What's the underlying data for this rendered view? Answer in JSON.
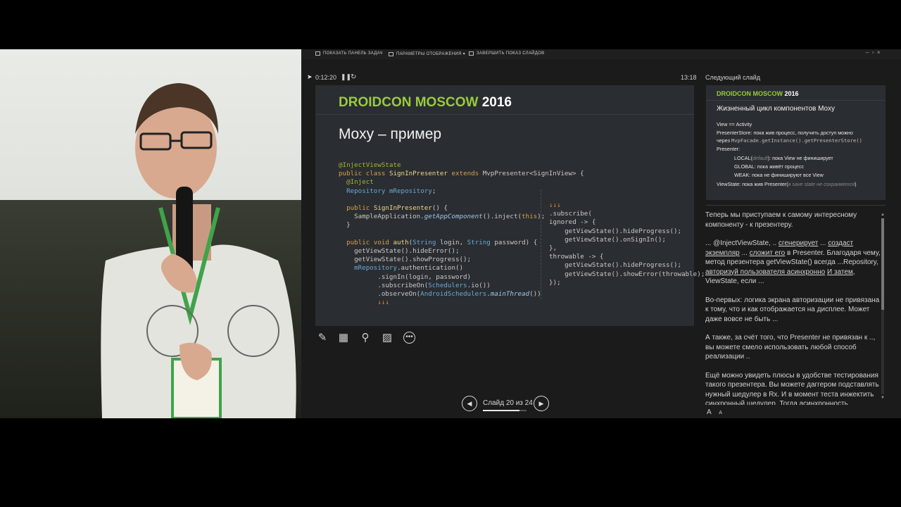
{
  "toolbar": {
    "show_taskbar": "ПОКАЗАТЬ ПАНЕЛЬ ЗАДАЧ",
    "display_settings": "ПАРАМЕТРЫ ОТОБРАЖЕНИЯ ▾",
    "end_show": "ЗАВЕРШИТЬ ПОКАЗ СЛАЙДОВ"
  },
  "timer": {
    "elapsed": "0:12:20",
    "clock": "13:18"
  },
  "slide": {
    "brand_a": "DROIDCON MOSCOW",
    "brand_b": "2016",
    "title": "Moxy – пример"
  },
  "next_slide": {
    "label": "Следующий слайд",
    "brand_a": "DROIDCON MOSCOW",
    "brand_b": "2016",
    "title": "Жизненный цикл компонентов Moxy",
    "line1": "View == Activity",
    "line2": "PresenterStore: пока жив процесс, получить доступ можно",
    "line3_a": "через ",
    "line3_code": "MvpFacade.getInstance().getPresenterStore()",
    "line4": "Presenter:",
    "line5_a": "LOCAL(",
    "line5_dim": "default",
    "line5_b": "): пока View не финиширует",
    "line6": "GLOBAL: пока живёт процесс",
    "line7": "WEAK: пока не финишируют все View",
    "line8_a": "ViewState: пока жив Presenter(",
    "line8_dim": "в save state не сохраняется",
    "line8_b": ")"
  },
  "notes": {
    "p1": "Теперь мы приступаем к самому интересному компоненту - к презентеру.",
    "p2_a": "... @InjectViewState, .. ",
    "p2_u1": "сгенерирует",
    "p2_b": " ... ",
    "p2_u2": "создаст экземпляр",
    "p2_c": " ... ",
    "p2_u3": "сложит его",
    "p2_d": " в Presenter. Благодаря чему, метод презентера getViewState() всегда ...Repository, ",
    "p2_u4": "авторизуй пользователя асинхронно",
    "p2_e": " ",
    "p2_u5": "И затем",
    "p2_f": ", ViewState, если ...",
    "p3": "Во-первых: логика экрана авторизации не привязана к тому, что и как отображается на дисплее. Может даже вовсе не быть ...",
    "p4": "А также, за счёт того, что Presenter не привязан к .., вы можете смело использовать любой способ реализации ..",
    "p5": "Ещё можно увидеть плюсы в удобстве тестирования такого презентера. Вы можете даггером подставлять нужный шедулер в Rx. И в момент теста инжектить синхронный шедулер. Тогда асинхронность"
  },
  "nav": {
    "slide_counter": "Слайд 20 из 24",
    "current": 20,
    "total": 24
  },
  "font_buttons": {
    "increase": "A",
    "decrease": "A"
  },
  "colors": {
    "accent_green": "#9acb3c",
    "slide_bg": "#2a2d31",
    "presenter_bg": "#1b1b1b"
  }
}
